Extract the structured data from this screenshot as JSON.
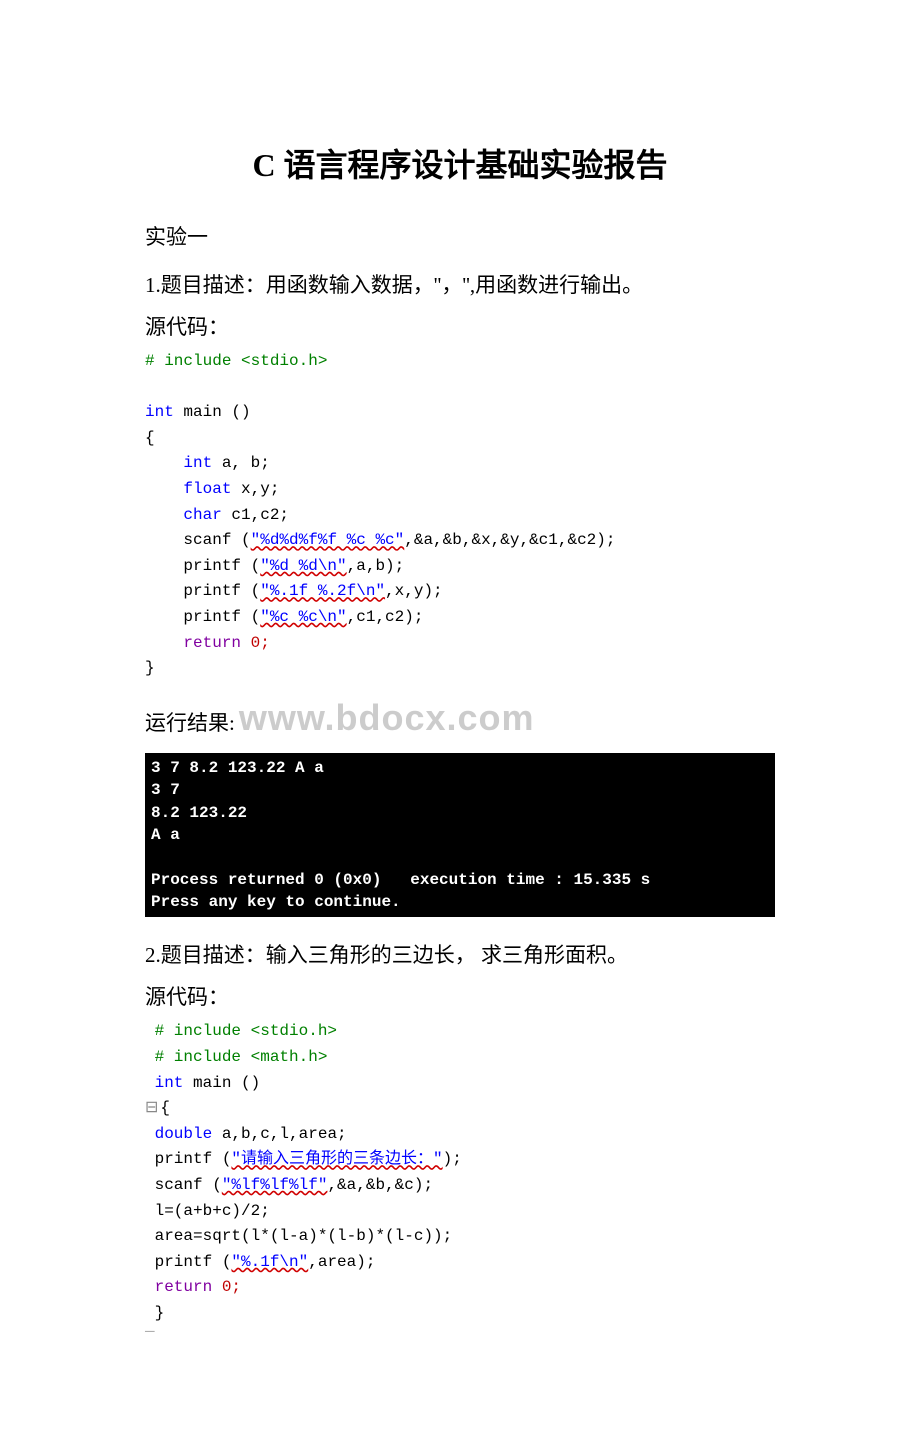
{
  "title": "C 语言程序设计基础实验报告",
  "exp_label": "实验一",
  "problem1": {
    "desc": "1.题目描述：用函数输入数据，''，'',用函数进行输出。",
    "source_label": "源代码：",
    "code": {
      "l1": "# include <stdio.h>",
      "l2": "",
      "l3a": "int",
      "l3b": " main ()",
      "l4": "{",
      "l5a": "int",
      "l5b": " a, b;",
      "l6a": "float",
      "l6b": " x,y;",
      "l7a": "char",
      "l7b": " c1,c2;",
      "l8a": "scanf (",
      "l8b": "\"%d%d%f%f %c %c\"",
      "l8c": ",&a,&b,&x,&y,&c1,&c2);",
      "l9a": "printf (",
      "l9b": "\"%d %d\\n\"",
      "l9c": ",a,b);",
      "l10a": "printf (",
      "l10b": "\"%.1f %.2f\\n\"",
      "l10c": ",x,y);",
      "l11a": "printf (",
      "l11b": "\"%c %c\\n\"",
      "l11c": ",c1,c2);",
      "l12a": "return",
      "l12b": " 0;",
      "l13": "}"
    },
    "result_label": "运行结果:",
    "watermark": "www.bdocx.com",
    "console": "3 7 8.2 123.22 A a\n3 7\n8.2 123.22\nA a\n\nProcess returned 0 (0x0)   execution time : 15.335 s\nPress any key to continue."
  },
  "problem2": {
    "desc": "2.题目描述：输入三角形的三边长， 求三角形面积。",
    "source_label": "源代码：",
    "code": {
      "l1": " # include <stdio.h>",
      "l2": " # include <math.h>",
      "l3a": " int",
      "l3b": " main ()",
      "l4g": "⊟",
      "l4": "{",
      "l5a": " double",
      "l5b": " a,b,c,l,area;",
      "l6a": " printf (",
      "l6b": "\"请输入三角形的三条边长：\"",
      "l6c": ");",
      "l7a": " scanf (",
      "l7b": "\"%lf%lf%lf\"",
      "l7c": ",&a,&b,&c);",
      "l8": " l=(a+b+c)/2;",
      "l9": " area=sqrt(l*(l-a)*(l-b)*(l-c));",
      "l10a": " printf (",
      "l10b": "\"%.1f\\n\"",
      "l10c": ",area);",
      "l11a": " return",
      "l11b": " 0;",
      "l12": " }",
      "l13g": "‾"
    }
  }
}
